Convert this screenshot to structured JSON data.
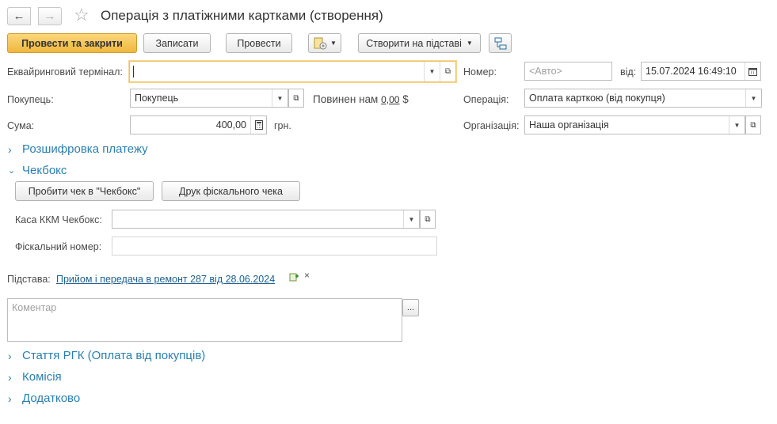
{
  "header": {
    "back_icon": "arrow-left-icon",
    "forward_icon": "arrow-right-icon",
    "favorite_icon": "star-icon",
    "title": "Операція з платіжними картками (створення)"
  },
  "toolbar": {
    "post_and_close": "Провести та закрити",
    "save": "Записати",
    "post": "Провести",
    "create_based_on": "Створити на підставі"
  },
  "form": {
    "terminal_label": "Еквайринговий термінал:",
    "terminal_value": "",
    "number_label": "Номер:",
    "number_placeholder": "<Авто>",
    "date_label": "від:",
    "date_value": "15.07.2024 16:49:10",
    "buyer_label": "Покупець:",
    "buyer_value": "Покупець",
    "owes_label": "Повинен нам",
    "owes_value": "0,00",
    "owes_currency": "$",
    "operation_label": "Операція:",
    "operation_value": "Оплата карткою (від покупця)",
    "sum_label": "Сума:",
    "sum_value": "400,00",
    "sum_currency": "грн.",
    "org_label": "Організація:",
    "org_value": "Наша організація"
  },
  "sections": {
    "payment_breakdown": "Розшифровка платежу",
    "checkbox": "Чекбокс",
    "rgk": "Стаття РГК (Оплата від покупців)",
    "commission": "Комісія",
    "additional": "Додатково"
  },
  "checkbox_section": {
    "print_check_button": "Пробити чек в \"Чекбокс\"",
    "print_fiscal_button": "Друк фіскального чека",
    "cash_register_label": "Каса ККМ Чекбокс:",
    "cash_register_value": "",
    "fiscal_number_label": "Фіскальний номер:",
    "fiscal_number_value": ""
  },
  "basis": {
    "label": "Підстава:",
    "link": "Прийом і передача в ремонт 287 від 28.06.2024",
    "clear": "×"
  },
  "comment": {
    "placeholder": "Коментар",
    "button": "..."
  }
}
